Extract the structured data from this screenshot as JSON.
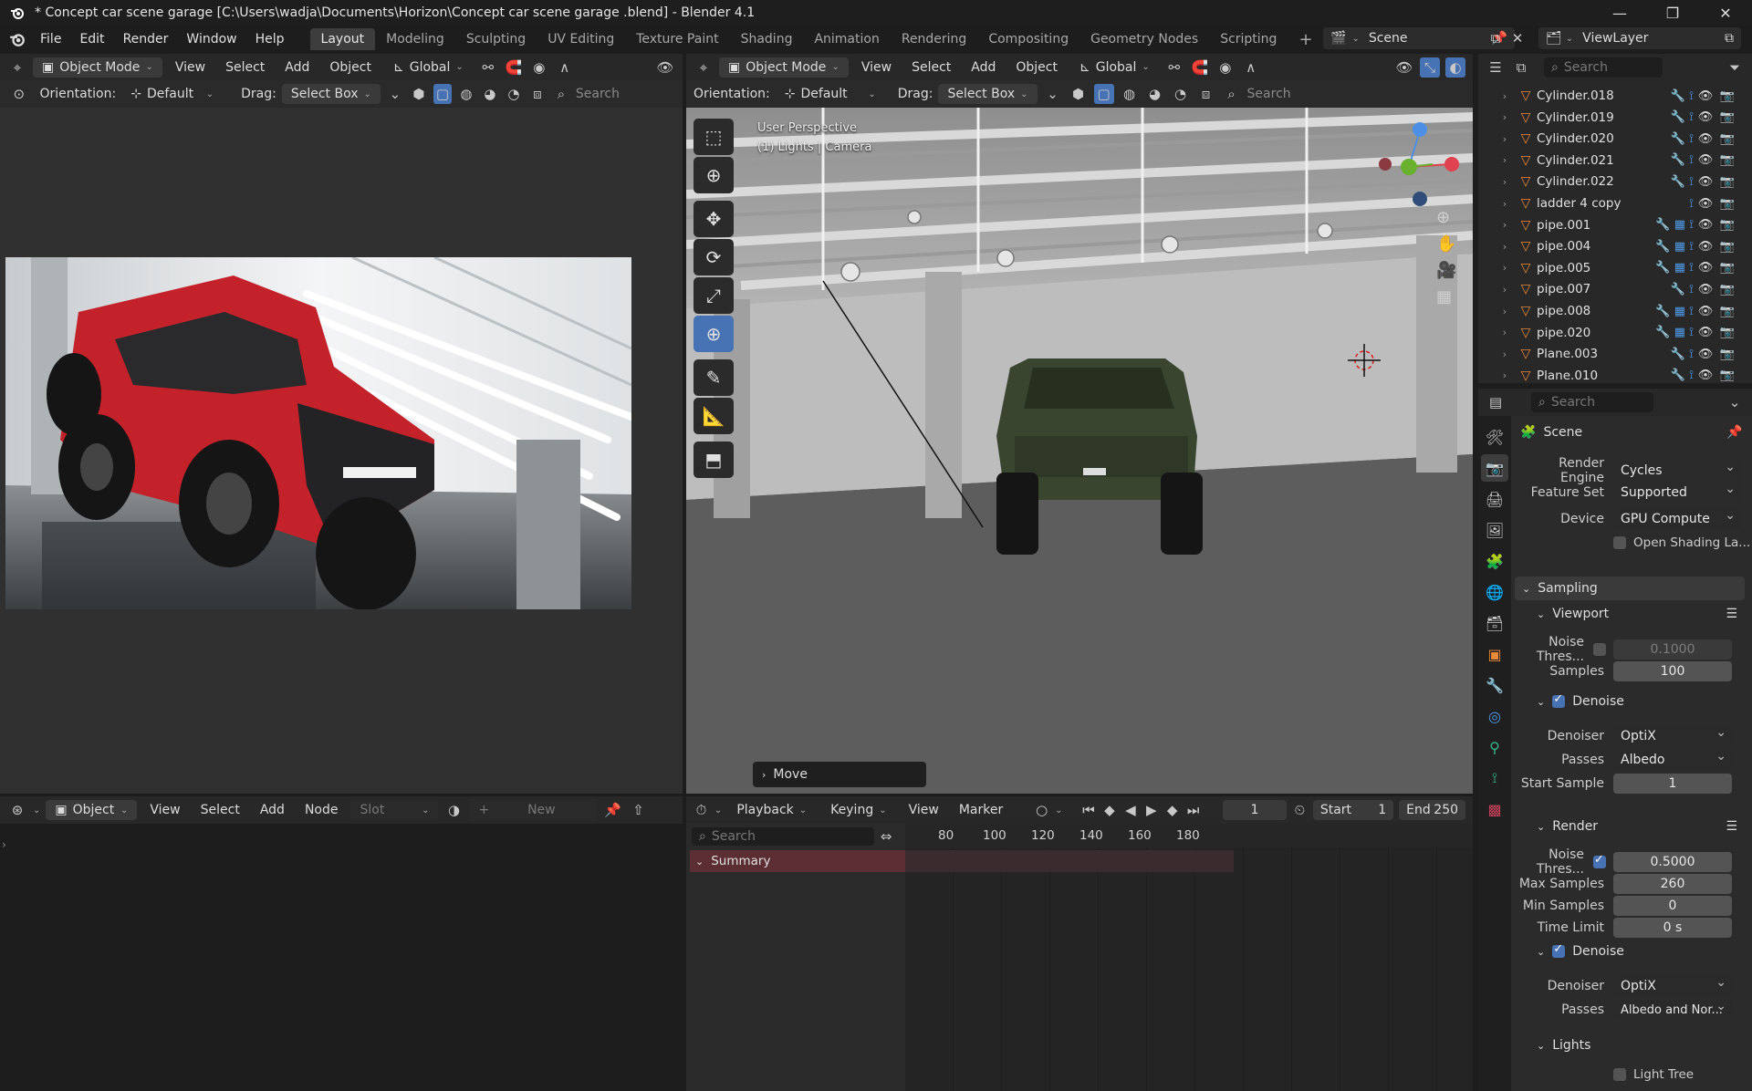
{
  "window": {
    "title": "* Concept car scene garage  [C:\\Users\\wadja\\Documents\\Horizon\\Concept car scene garage .blend] - Blender 4.1"
  },
  "menus": [
    "File",
    "Edit",
    "Render",
    "Window",
    "Help"
  ],
  "workspaces": [
    "Layout",
    "Modeling",
    "Sculpting",
    "UV Editing",
    "Texture Paint",
    "Shading",
    "Animation",
    "Rendering",
    "Compositing",
    "Geometry Nodes",
    "Scripting"
  ],
  "scene_name": "Scene",
  "viewlayer_name": "ViewLayer",
  "left_viewport": {
    "mode": "Object Mode",
    "menus": [
      "View",
      "Select",
      "Add",
      "Object"
    ],
    "transform": "Global",
    "orientation_label": "Orientation:",
    "orientation": "Default",
    "drag_label": "Drag:",
    "drag": "Select Box",
    "search_placeholder": "Search"
  },
  "main_viewport": {
    "mode": "Object Mode",
    "menus": [
      "View",
      "Select",
      "Add",
      "Object"
    ],
    "transform": "Global",
    "orientation_label": "Orientation:",
    "orientation": "Default",
    "drag_label": "Drag:",
    "drag": "Select Box",
    "search_placeholder": "Search",
    "overlay_line1": "User Perspective",
    "overlay_line2": "(1) Lights | Camera",
    "last_op": "Move"
  },
  "shader_editor": {
    "mode": "Object",
    "menus": [
      "View",
      "Select",
      "Add",
      "Node"
    ],
    "slot": "Slot",
    "new_label": "New"
  },
  "timeline": {
    "menus": [
      "Playback",
      "Keying",
      "View",
      "Marker"
    ],
    "current_frame": "1",
    "start_label": "Start",
    "start": "1",
    "end_label": "End",
    "end": "250",
    "search_placeholder": "Search",
    "ruler": [
      "80",
      "100",
      "120",
      "140",
      "160",
      "180"
    ],
    "summary": "Summary"
  },
  "outliner": {
    "search_placeholder": "Search",
    "items": [
      {
        "name": "Cylinder.018",
        "mods": "🔧 ⟟"
      },
      {
        "name": "Cylinder.019",
        "mods": "🔧 ⟟"
      },
      {
        "name": "Cylinder.020",
        "mods": "🔧 ⟟"
      },
      {
        "name": "Cylinder.021",
        "mods": "🔧 ⟟"
      },
      {
        "name": "Cylinder.022",
        "mods": "🔧 ⟟"
      },
      {
        "name": "ladder 4 copy",
        "mods": "⟟"
      },
      {
        "name": "pipe.001",
        "mods": "🔧 ▦ ⟟"
      },
      {
        "name": "pipe.004",
        "mods": "🔧 ▦ ⟟"
      },
      {
        "name": "pipe.005",
        "mods": "🔧 ▦ ⟟"
      },
      {
        "name": "pipe.007",
        "mods": "🔧 ⟟"
      },
      {
        "name": "pipe.008",
        "mods": "🔧 ▦ ⟟"
      },
      {
        "name": "pipe.020",
        "mods": "🔧 ▦ ⟟"
      },
      {
        "name": "Plane.003",
        "mods": "🔧 ⟟"
      },
      {
        "name": "Plane.010",
        "mods": "🔧 ⟟"
      }
    ]
  },
  "properties": {
    "search_placeholder": "Search",
    "context": "Scene",
    "render_engine_label": "Render Engine",
    "render_engine": "Cycles",
    "feature_set_label": "Feature Set",
    "feature_set": "Supported",
    "device_label": "Device",
    "device": "GPU Compute",
    "open_shading": "Open Shading La...",
    "sampling": "Sampling",
    "viewport": "Viewport",
    "vp_noise_label": "Noise Thres...",
    "vp_noise": "0.1000",
    "vp_samples_label": "Samples",
    "vp_samples": "100",
    "vp_denoise": "Denoise",
    "vp_denoiser_label": "Denoiser",
    "vp_denoiser": "OptiX",
    "vp_passes_label": "Passes",
    "vp_passes": "Albedo",
    "vp_start_label": "Start Sample",
    "vp_start": "1",
    "render": "Render",
    "r_noise_label": "Noise Thres...",
    "r_noise": "0.5000",
    "r_max_label": "Max Samples",
    "r_max": "260",
    "r_min_label": "Min Samples",
    "r_min": "0",
    "r_time_label": "Time Limit",
    "r_time": "0 s",
    "r_denoise": "Denoise",
    "r_denoiser_label": "Denoiser",
    "r_denoiser": "OptiX",
    "r_passes_label": "Passes",
    "r_passes": "Albedo and Nor...",
    "lights": "Lights",
    "light_tree": "Light Tree"
  },
  "colors": {
    "accent": "#4772b3",
    "object_orange": "#e8893a",
    "car_red": "#c3222b",
    "car_green": "#3a4530"
  }
}
